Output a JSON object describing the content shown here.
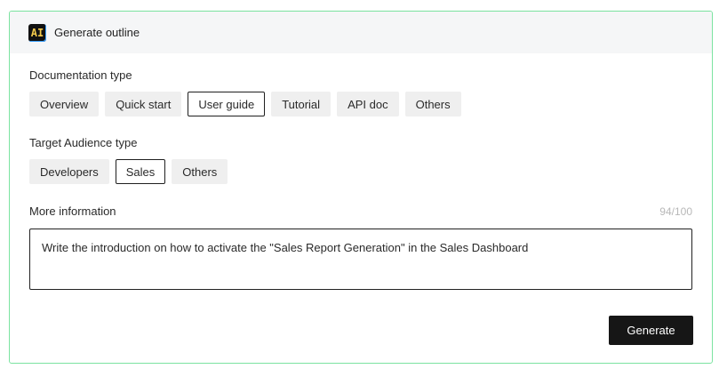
{
  "header": {
    "badge": "AI",
    "title": "Generate outline"
  },
  "doc_type": {
    "label": "Documentation type",
    "options": [
      "Overview",
      "Quick start",
      "User guide",
      "Tutorial",
      "API doc",
      "Others"
    ],
    "selected": "User guide"
  },
  "audience": {
    "label": "Target Audience type",
    "options": [
      "Developers",
      "Sales",
      "Others"
    ],
    "selected": "Sales"
  },
  "more_info": {
    "label": "More information",
    "counter": "94/100",
    "value": "Write the introduction on how to activate the \"Sales Report Generation\" in the Sales Dashboard"
  },
  "actions": {
    "generate_label": "Generate"
  },
  "colors": {
    "border_accent": "#7be3a0",
    "button_bg": "#161616",
    "chip_bg": "#efefef"
  }
}
